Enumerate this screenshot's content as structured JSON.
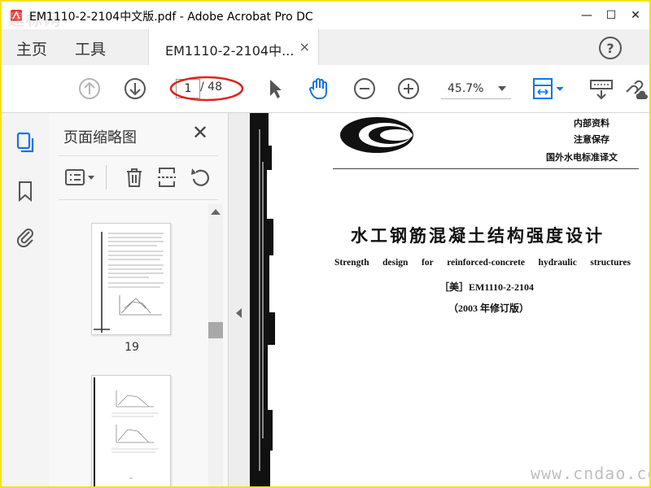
{
  "window": {
    "title": "EM1110-2-2104中文版.pdf - Adobe Acrobat Pro DC",
    "corner_watermark": "建标网",
    "controls": {
      "minimize": "—",
      "maximize": "☐",
      "close": "✕"
    }
  },
  "nav_tabs": {
    "home": "主页",
    "tools": "工具"
  },
  "doc_tab": {
    "label": "EM1110-2-2104中...",
    "close": "×"
  },
  "help": "?",
  "toolbar": {
    "page_current": "1",
    "page_total": "/ 48",
    "zoom": "45.7%",
    "icons": [
      "arrow-up-circle-icon",
      "arrow-down-circle-icon",
      "select-cursor-icon",
      "hand-tool-icon",
      "zoom-out-icon",
      "zoom-in-icon",
      "fit-page-icon",
      "scroll-mode-icon",
      "link-cloud-icon"
    ]
  },
  "panel": {
    "title": "页面缩略图",
    "close": "✕",
    "thumbnails": [
      {
        "label": "19"
      },
      {
        "label": ""
      }
    ]
  },
  "document": {
    "side_notes": [
      "内部资料",
      "注意保存",
      "国外水电标准译文"
    ],
    "title_cn": "水工钢筋混凝土结构强度设计",
    "title_en": [
      "Strength",
      "design",
      "for",
      "reinforced-concrete",
      "hydraulic",
      "structures"
    ],
    "code": "［美］EM1110-2-2104",
    "edition": "（2003 年修订版）"
  },
  "watermark": "www.cndao.com",
  "colors": {
    "border": "#f3e21c",
    "accent_blue": "#1473e6",
    "annotation_red": "#e0231c"
  }
}
